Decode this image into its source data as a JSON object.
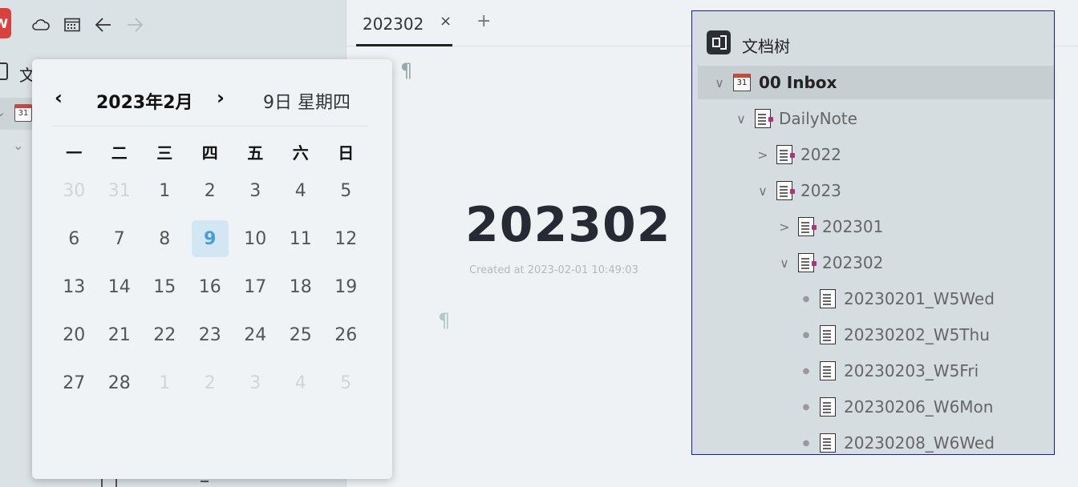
{
  "sidebar": {
    "app_logo": "W",
    "toolbar_icons": [
      "cloud-icon",
      "calendar-icon",
      "back-arrow-icon",
      "forward-arrow-icon"
    ],
    "tree_label": "文",
    "cal_day": "31"
  },
  "tabs": [
    {
      "label": "202302",
      "close": "×"
    }
  ],
  "tab_add": "+",
  "editor": {
    "pilcrow": "¶",
    "title": "202302",
    "created": "Created at 2023-02-01 10:49:03"
  },
  "calendar": {
    "prev": "‹",
    "next": "›",
    "month": "2023年2月",
    "today_label": "9日  星期四",
    "weekdays": [
      "一",
      "二",
      "三",
      "四",
      "五",
      "六",
      "日"
    ],
    "days": [
      {
        "d": "30",
        "other": true
      },
      {
        "d": "31",
        "other": true
      },
      {
        "d": "1"
      },
      {
        "d": "2"
      },
      {
        "d": "3"
      },
      {
        "d": "4"
      },
      {
        "d": "5"
      },
      {
        "d": "6"
      },
      {
        "d": "7"
      },
      {
        "d": "8"
      },
      {
        "d": "9",
        "selected": true
      },
      {
        "d": "10"
      },
      {
        "d": "11"
      },
      {
        "d": "12"
      },
      {
        "d": "13"
      },
      {
        "d": "14"
      },
      {
        "d": "15"
      },
      {
        "d": "16"
      },
      {
        "d": "17"
      },
      {
        "d": "18"
      },
      {
        "d": "19"
      },
      {
        "d": "20"
      },
      {
        "d": "21"
      },
      {
        "d": "22"
      },
      {
        "d": "23"
      },
      {
        "d": "24"
      },
      {
        "d": "25"
      },
      {
        "d": "26"
      },
      {
        "d": "27"
      },
      {
        "d": "28"
      },
      {
        "d": "1",
        "other": true
      },
      {
        "d": "2",
        "other": true
      },
      {
        "d": "3",
        "other": true
      },
      {
        "d": "4",
        "other": true
      },
      {
        "d": "5",
        "other": true
      }
    ]
  },
  "doc_tree": {
    "title": "文档树",
    "items": [
      {
        "label": "00 Inbox",
        "depth": 0,
        "toggle": "expanded",
        "icon": "calendar-icon",
        "cal_text": "31",
        "active": true
      },
      {
        "label": "DailyNote",
        "depth": 1,
        "toggle": "expanded",
        "icon": "doc-icon"
      },
      {
        "label": "2022",
        "depth": 2,
        "toggle": "collapsed",
        "icon": "doc-icon"
      },
      {
        "label": "2023",
        "depth": 2,
        "toggle": "expanded",
        "icon": "doc-icon"
      },
      {
        "label": "202301",
        "depth": 3,
        "toggle": "collapsed",
        "icon": "doc-icon"
      },
      {
        "label": "202302",
        "depth": 3,
        "toggle": "expanded",
        "icon": "doc-icon"
      },
      {
        "label": "20230201_W5Wed",
        "depth": 4,
        "toggle": "leaf",
        "icon": "doc-icon"
      },
      {
        "label": "20230202_W5Thu",
        "depth": 4,
        "toggle": "leaf",
        "icon": "doc-icon"
      },
      {
        "label": "20230203_W5Fri",
        "depth": 4,
        "toggle": "leaf",
        "icon": "doc-icon"
      },
      {
        "label": "20230206_W6Mon",
        "depth": 4,
        "toggle": "leaf",
        "icon": "doc-icon"
      },
      {
        "label": "20230208_W6Wed",
        "depth": 4,
        "toggle": "leaf",
        "icon": "doc-icon"
      }
    ]
  }
}
